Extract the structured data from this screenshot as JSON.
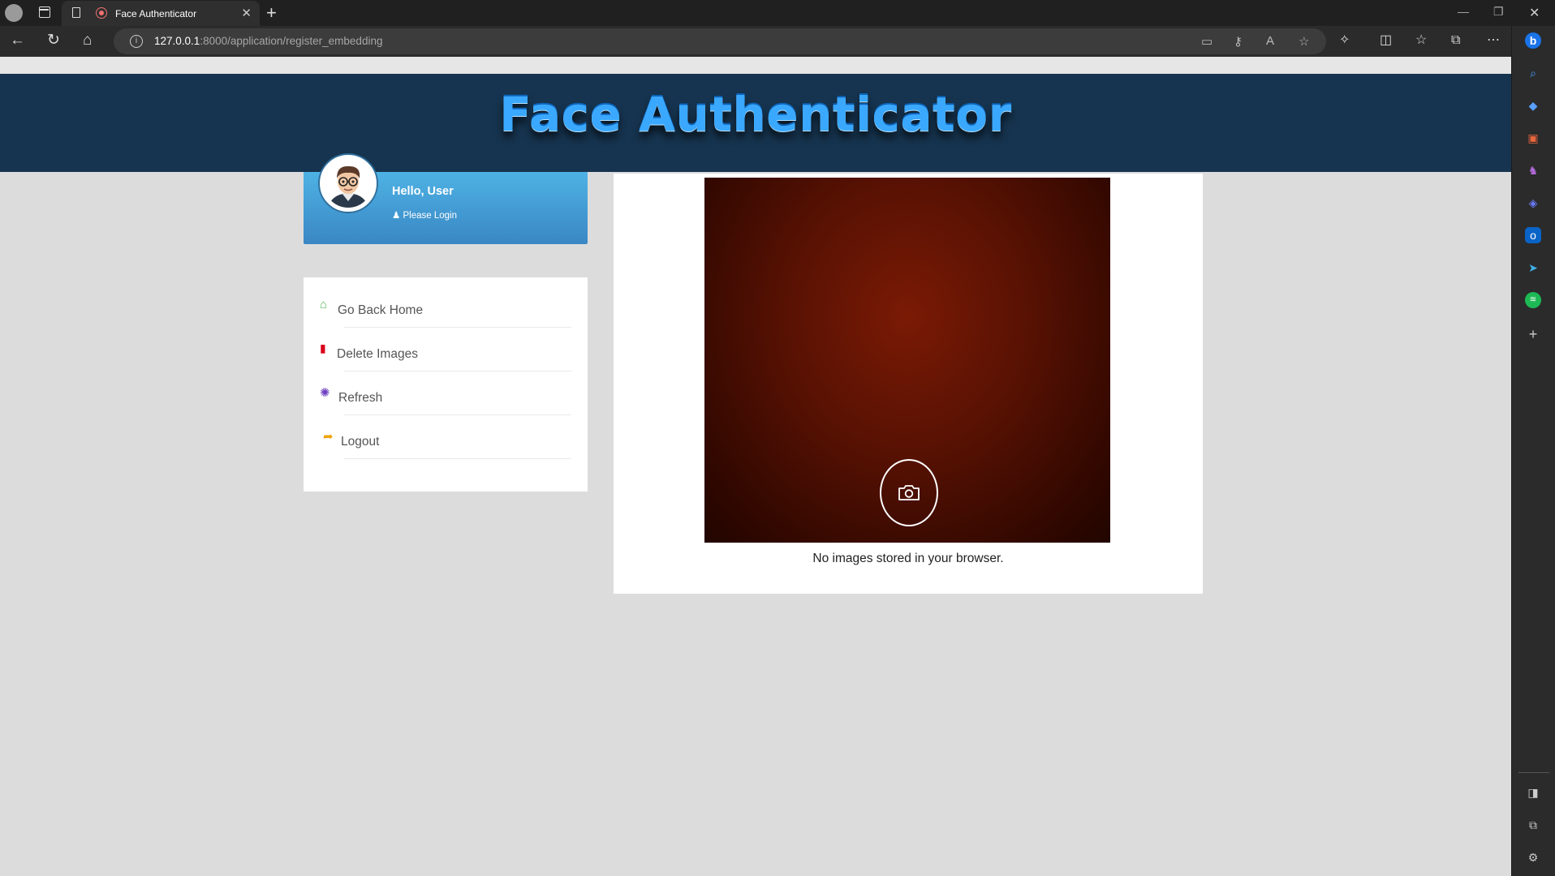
{
  "browser": {
    "tab_title": "Face Authenticator",
    "url_host": "127.0.0.1",
    "url_rest": ":8000/application/register_embedding"
  },
  "header": {
    "title": "Face Authenticator"
  },
  "user": {
    "greeting": "Hello, User",
    "login_hint": "Please Login"
  },
  "menu": {
    "items": [
      {
        "label": "Go Back Home",
        "icon": "home-icon",
        "color": "#5cb85c"
      },
      {
        "label": "Delete Images",
        "icon": "trash-icon",
        "color": "#d9001b"
      },
      {
        "label": "Refresh",
        "icon": "spinner-icon",
        "color": "#6f42c1"
      },
      {
        "label": "Logout",
        "icon": "sign-out-icon",
        "color": "#f0a30a"
      }
    ]
  },
  "camera": {
    "empty_message": "No images stored in your browser."
  }
}
